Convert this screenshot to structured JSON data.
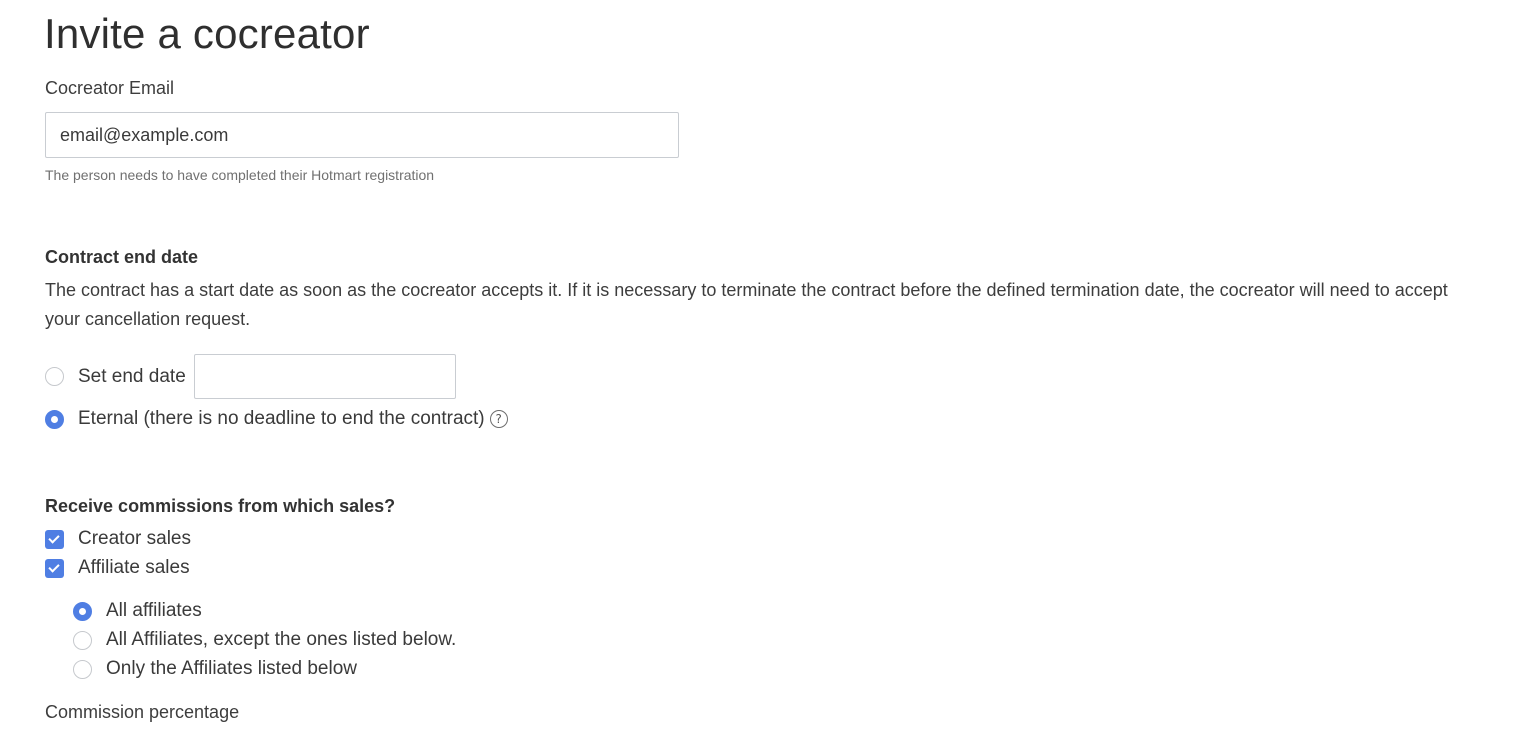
{
  "header": {
    "title": "Invite a cocreator"
  },
  "email": {
    "label": "Cocreator Email",
    "placeholder": "email@example.com",
    "value": "",
    "help": "The person needs to have completed their Hotmart registration"
  },
  "contract": {
    "title": "Contract end date",
    "description": "The contract has a start date as soon as the cocreator accepts it. If it is necessary to terminate the contract before the defined termination date, the cocreator will need to accept your cancellation request.",
    "options": [
      {
        "label": "Set end date",
        "selected": false
      },
      {
        "label": "Eternal (there is no deadline to end the contract)",
        "selected": true
      }
    ],
    "end_date_value": "",
    "help_icon": "question-circle-icon",
    "help_glyph": "?"
  },
  "commissions": {
    "title": "Receive commissions from which sales?",
    "sale_types": [
      {
        "label": "Creator sales",
        "checked": true
      },
      {
        "label": "Affiliate sales",
        "checked": true
      }
    ],
    "affiliate_options": [
      {
        "label": "All affiliates",
        "selected": true
      },
      {
        "label": "All Affiliates, except the ones listed below.",
        "selected": false
      },
      {
        "label": "Only the Affiliates listed below",
        "selected": false
      }
    ],
    "percentage_label": "Commission percentage"
  },
  "colors": {
    "accent": "#4f7ee3",
    "text": "#3a3a3a",
    "muted": "#707070",
    "border": "#c9cdd2"
  }
}
